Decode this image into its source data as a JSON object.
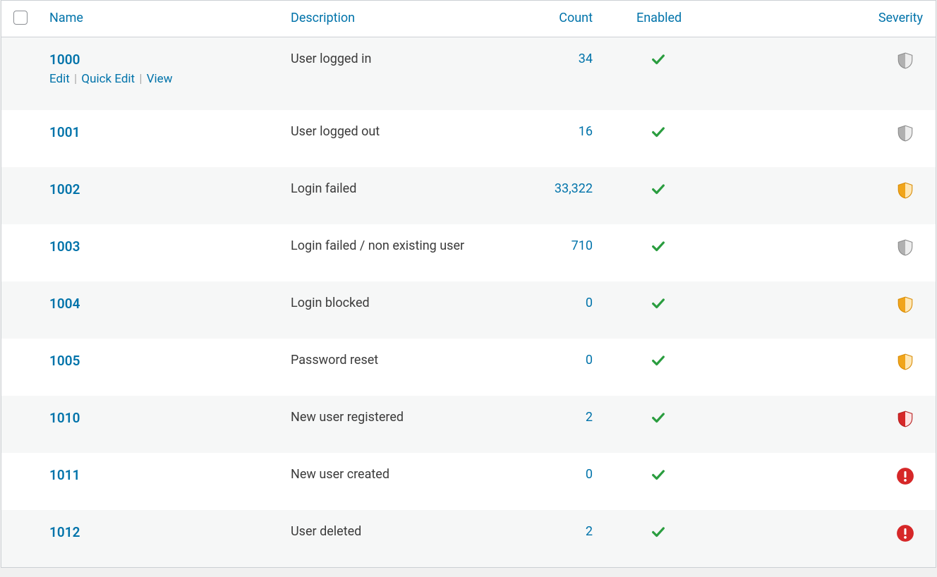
{
  "headers": {
    "name": "Name",
    "description": "Description",
    "count": "Count",
    "enabled": "Enabled",
    "severity": "Severity"
  },
  "row_actions": {
    "edit": "Edit",
    "quick_edit": "Quick Edit",
    "view": "View"
  },
  "rows": [
    {
      "id": "1000",
      "description": "User logged in",
      "count": "34",
      "enabled": true,
      "severity": "shield-grey"
    },
    {
      "id": "1001",
      "description": "User logged out",
      "count": "16",
      "enabled": true,
      "severity": "shield-grey"
    },
    {
      "id": "1002",
      "description": "Login failed",
      "count": "33,322",
      "enabled": true,
      "severity": "shield-orange"
    },
    {
      "id": "1003",
      "description": "Login failed / non existing user",
      "count": "710",
      "enabled": true,
      "severity": "shield-grey"
    },
    {
      "id": "1004",
      "description": "Login blocked",
      "count": "0",
      "enabled": true,
      "severity": "shield-orange"
    },
    {
      "id": "1005",
      "description": "Password reset",
      "count": "0",
      "enabled": true,
      "severity": "shield-orange"
    },
    {
      "id": "1010",
      "description": "New user registered",
      "count": "2",
      "enabled": true,
      "severity": "shield-red"
    },
    {
      "id": "1011",
      "description": "New user created",
      "count": "0",
      "enabled": true,
      "severity": "circle-alert"
    },
    {
      "id": "1012",
      "description": "User deleted",
      "count": "2",
      "enabled": true,
      "severity": "circle-alert"
    }
  ]
}
